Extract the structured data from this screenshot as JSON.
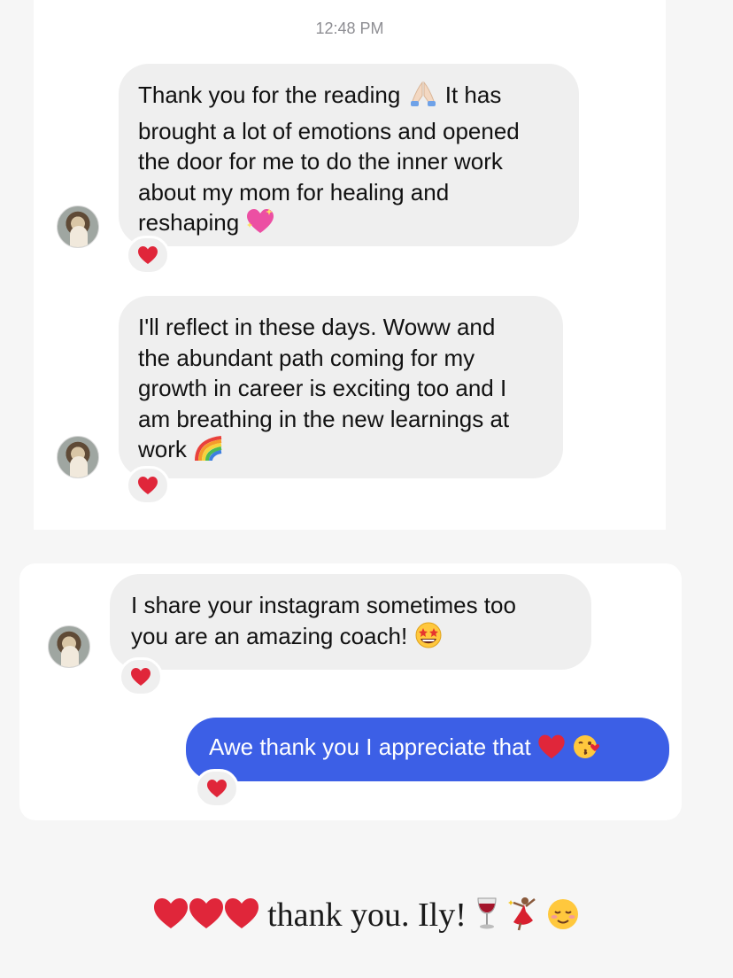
{
  "timestamp": "12:48 PM",
  "messages": [
    {
      "direction": "incoming",
      "lines": [
        "Thank you for the reading",
        "brought a lot of emotions and opened",
        "the door for me to do the inner work",
        "about my mom for healing and",
        "reshaping"
      ],
      "line1_tail": "It has",
      "emojis": [
        "folded-hands-emoji",
        "sparkling-heart-emoji"
      ],
      "reaction": "red-heart"
    },
    {
      "direction": "incoming",
      "lines": [
        "I'll reflect in these days. Woww and",
        "the abundant path coming for my",
        "growth in career is exciting too and I",
        "am breathing in the new learnings at",
        "work"
      ],
      "emojis": [
        "rainbow-emoji"
      ],
      "reaction": "red-heart"
    },
    {
      "direction": "incoming",
      "lines": [
        "I share your instagram sometimes too",
        "you are an amazing coach!"
      ],
      "emojis": [
        "star-struck-emoji"
      ],
      "reaction": "red-heart"
    },
    {
      "direction": "outgoing",
      "lines": [
        "Awe thank you I appreciate that"
      ],
      "emojis": [
        "red-heart-emoji",
        "face-blowing-kiss-emoji"
      ],
      "reaction": "red-heart"
    }
  ],
  "footer": {
    "text": "thank you. Ily!",
    "emojis": [
      "red-heart",
      "red-heart",
      "red-heart",
      "wine-glass",
      "dancer",
      "smiling-face"
    ]
  },
  "colors": {
    "incoming_bubble": "#efefef",
    "outgoing_bubble": "#3c5fe6",
    "heart": "#e0263a"
  }
}
